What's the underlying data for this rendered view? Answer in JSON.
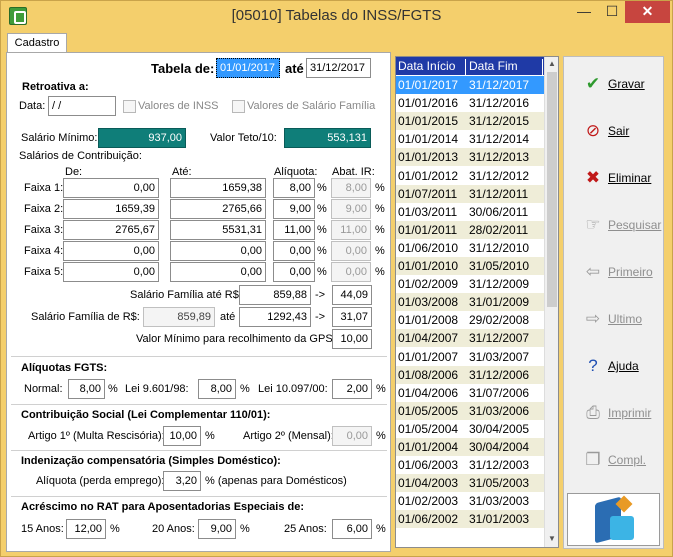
{
  "window": {
    "title": "[05010] Tabelas do INSS/FGTS",
    "min_glyph": "—",
    "max_glyph": "☐",
    "close_glyph": "✕"
  },
  "tab": {
    "label": "Cadastro"
  },
  "form": {
    "tabela_label": "Tabela de:",
    "tabela_de": "01/01/2017",
    "ate_label": "até",
    "tabela_ate": "31/12/2017",
    "retro_label": "Retroativa a:",
    "data_label": "Data:",
    "data_value": " /  /",
    "valores_inss": "Valores de INSS",
    "valores_sal_fam": "Valores de Salário Família",
    "salario_minimo_label": "Salário Mínimo:",
    "salario_minimo": "937,00",
    "valor_teto_label": "Valor Teto/10:",
    "valor_teto": "553,131",
    "sal_contrib_label": "Salários de Contribuição:",
    "col_de": "De:",
    "col_ate": "Até:",
    "col_aliq": "Alíquota:",
    "col_abat": "Abat. IR:",
    "faixas": [
      {
        "label": "Faixa 1:",
        "de": "0,00",
        "ate": "1659,38",
        "aliq": "8,00",
        "abat": "8,00"
      },
      {
        "label": "Faixa 2:",
        "de": "1659,39",
        "ate": "2765,66",
        "aliq": "9,00",
        "abat": "9,00"
      },
      {
        "label": "Faixa 3:",
        "de": "2765,67",
        "ate": "5531,31",
        "aliq": "11,00",
        "abat": "11,00"
      },
      {
        "label": "Faixa 4:",
        "de": "0,00",
        "ate": "0,00",
        "aliq": "0,00",
        "abat": "0,00"
      },
      {
        "label": "Faixa 5:",
        "de": "0,00",
        "ate": "0,00",
        "aliq": "0,00",
        "abat": "0,00"
      }
    ],
    "pct": "%",
    "sf_ate_label": "Salário Família até R$:",
    "sf_ate": "859,88",
    "arrow": "->",
    "sf_ate_val": "44,09",
    "sf_de_label": "Salário Família de R$:",
    "sf_de": "859,89",
    "sf_de_ate_label": "até",
    "sf_de_ate": "1292,43",
    "sf_de_val": "31,07",
    "gps_label": "Valor Mínimo para recolhimento da GPS:",
    "gps": "10,00",
    "fgts_title": "Alíquotas FGTS:",
    "normal_label": "Normal:",
    "normal": "8,00",
    "lei9601_label": "Lei 9.601/98:",
    "lei9601": "8,00",
    "lei10097_label": "Lei 10.097/00:",
    "lei10097": "2,00",
    "contrib_title": "Contribuição Social (Lei Complementar 110/01):",
    "art1_label": "Artigo 1º (Multa Rescisória):",
    "art1": "10,00",
    "art2_label": "Artigo 2º (Mensal):",
    "art2": "0,00",
    "inden_title": "Indenização compensatória (Simples Doméstico):",
    "inden_label": "Alíquota (perda emprego):",
    "inden": "3,20",
    "inden_note": "% (apenas para Domésticos)",
    "rat_title": "Acréscimo no RAT para Aposentadorias Especiais de:",
    "rat15_label": "15 Anos:",
    "rat15": "12,00",
    "rat20_label": "20 Anos:",
    "rat20": "9,00",
    "rat25_label": "25 Anos:",
    "rat25": "6,00"
  },
  "grid": {
    "headers": [
      "Data Início",
      "Data Fim"
    ],
    "rows": [
      [
        "01/01/2017",
        "31/12/2017"
      ],
      [
        "01/01/2016",
        "31/12/2016"
      ],
      [
        "01/01/2015",
        "31/12/2015"
      ],
      [
        "01/01/2014",
        "31/12/2014"
      ],
      [
        "01/01/2013",
        "31/12/2013"
      ],
      [
        "01/01/2012",
        "31/12/2012"
      ],
      [
        "01/07/2011",
        "31/12/2011"
      ],
      [
        "01/03/2011",
        "30/06/2011"
      ],
      [
        "01/01/2011",
        "28/02/2011"
      ],
      [
        "01/06/2010",
        "31/12/2010"
      ],
      [
        "01/01/2010",
        "31/05/2010"
      ],
      [
        "01/02/2009",
        "31/12/2009"
      ],
      [
        "01/03/2008",
        "31/01/2009"
      ],
      [
        "01/01/2008",
        "29/02/2008"
      ],
      [
        "01/04/2007",
        "31/12/2007"
      ],
      [
        "01/01/2007",
        "31/03/2007"
      ],
      [
        "01/08/2006",
        "31/12/2006"
      ],
      [
        "01/04/2006",
        "31/07/2006"
      ],
      [
        "01/05/2005",
        "31/03/2006"
      ],
      [
        "01/05/2004",
        "30/04/2005"
      ],
      [
        "01/01/2004",
        "30/04/2004"
      ],
      [
        "01/06/2003",
        "31/12/2003"
      ],
      [
        "01/04/2003",
        "31/05/2003"
      ],
      [
        "01/02/2003",
        "31/03/2003"
      ],
      [
        "01/06/2002",
        "31/01/2003"
      ]
    ]
  },
  "buttons": [
    {
      "label": "Gravar",
      "icon": "check-icon",
      "glyph": "✔",
      "enabled": true,
      "color": "#2f9a2f"
    },
    {
      "label": "Sair",
      "icon": "no-entry-icon",
      "glyph": "⊘",
      "enabled": true,
      "color": "#c01818"
    },
    {
      "label": "Eliminar",
      "icon": "x-icon",
      "glyph": "✖",
      "enabled": true,
      "color": "#c01818"
    },
    {
      "label": "Pesquisar",
      "icon": "pointing-hand-icon",
      "glyph": "☞",
      "enabled": false,
      "color": "#9a9a9a"
    },
    {
      "label": "Primeiro",
      "icon": "arrow-left-icon",
      "glyph": "⇦",
      "enabled": false,
      "color": "#9a9a9a"
    },
    {
      "label": "Ultimo",
      "icon": "arrow-right-icon",
      "glyph": "⇨",
      "enabled": false,
      "color": "#9a9a9a"
    },
    {
      "label": "Ajuda",
      "icon": "question-icon",
      "glyph": "?",
      "enabled": true,
      "color": "#1f4fb3"
    },
    {
      "label": "Imprimir",
      "icon": "printer-icon",
      "glyph": "⎙",
      "enabled": false,
      "color": "#9a9a9a"
    },
    {
      "label": "Compl.",
      "icon": "copy-icon",
      "glyph": "❐",
      "enabled": false,
      "color": "#9a9a9a"
    }
  ],
  "colors": {
    "selected_row": "#3399ff",
    "alt_row": "#efedd8",
    "header": "#1f3aa6",
    "teal_field": "#0f7e79"
  }
}
